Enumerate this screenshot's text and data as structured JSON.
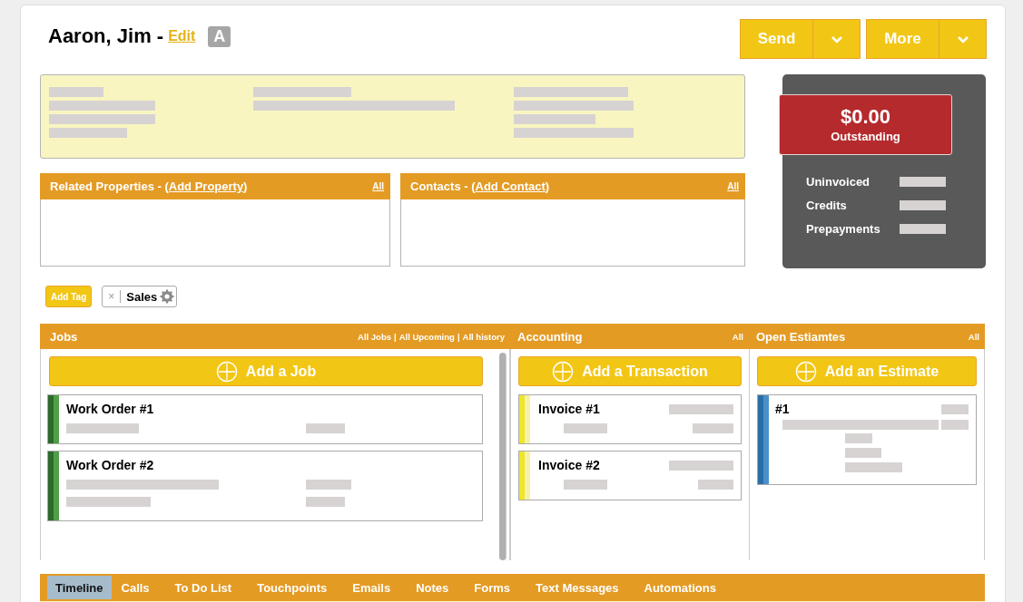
{
  "header": {
    "name": "Aaron, Jim -",
    "edit_link": "Edit",
    "badge": "A"
  },
  "actions": [
    {
      "label": "Send"
    },
    {
      "label": "More"
    }
  ],
  "panels": [
    {
      "prefix": "Related Properties - (",
      "link": "Add Property",
      "suffix": ")",
      "all": "All"
    },
    {
      "prefix": "Contacts - (",
      "link": "Add Contact",
      "suffix": ")",
      "all": "All"
    }
  ],
  "balance": {
    "amount": "$0.00",
    "label": "Outstanding",
    "rows": [
      {
        "label": "Uninvoiced"
      },
      {
        "label": "Credits"
      },
      {
        "label": "Prepayments"
      }
    ]
  },
  "tags": {
    "add_button": "Add Tag",
    "items": [
      {
        "label": "Sales",
        "remove": "×"
      }
    ]
  },
  "sections": [
    {
      "kind": "jobs",
      "title": "Jobs",
      "links": [
        "All Jobs",
        "All Upcoming",
        "All history"
      ],
      "separator": "|",
      "add_button": "Add a Job",
      "cards": [
        {
          "title": "Work Order #1"
        },
        {
          "title": "Work Order #2"
        }
      ]
    },
    {
      "kind": "accounting",
      "title": "Accounting",
      "links": [
        "All"
      ],
      "add_button": "Add a Transaction",
      "cards": [
        {
          "title": "Invoice #1"
        },
        {
          "title": "Invoice #2"
        }
      ]
    },
    {
      "kind": "estimates",
      "title": "Open Estiamtes",
      "links": [
        "All"
      ],
      "add_button": "Add an Estimate",
      "cards": [
        {
          "title": "#1"
        }
      ]
    }
  ],
  "tabs": [
    {
      "label": "Timeline",
      "selected": true
    },
    {
      "label": "Calls",
      "selected": false
    },
    {
      "label": "To Do List",
      "selected": false
    },
    {
      "label": "Touchpoints",
      "selected": false
    },
    {
      "label": "Emails",
      "selected": false
    },
    {
      "label": "Notes",
      "selected": false
    },
    {
      "label": "Forms",
      "selected": false
    },
    {
      "label": "Text Messages",
      "selected": false
    },
    {
      "label": "Automations",
      "selected": false
    }
  ]
}
